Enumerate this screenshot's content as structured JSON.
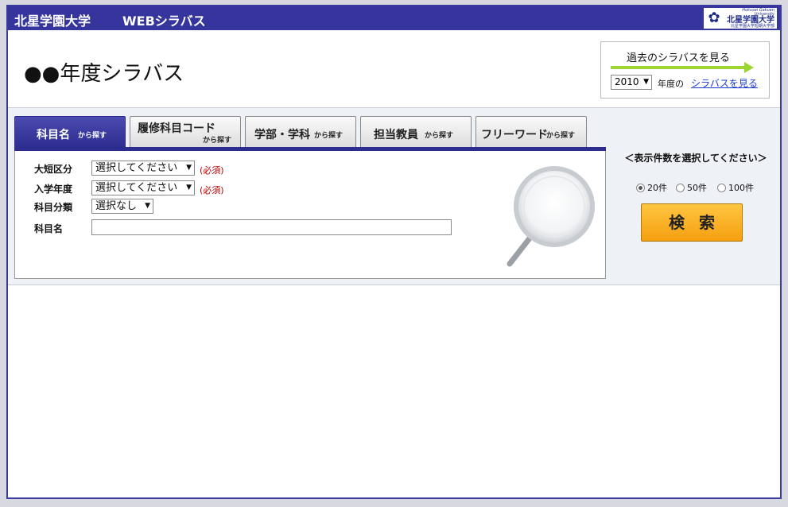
{
  "header": {
    "brand": "北星学園大学",
    "system_name": "WEBシラバス",
    "logo": {
      "en": "Hokusei Gakuen University",
      "jp": "北星学園大学",
      "sub": "北星学園大学短期大学部"
    }
  },
  "page_title": "●●年度シラバス",
  "past": {
    "label": "過去のシラバスを見る",
    "year_value": "2010",
    "year_suffix": "年度の",
    "link": "シラバスを見る"
  },
  "tabs": [
    {
      "main": "科目名",
      "small": "から探す",
      "active": true
    },
    {
      "main": "履修科目コード",
      "small": "から探す",
      "active": false
    },
    {
      "main": "学部・学科",
      "small": "から探す",
      "active": false
    },
    {
      "main": "担当教員",
      "small": "から探す",
      "active": false
    },
    {
      "main": "フリーワード",
      "small": "から探す",
      "active": false
    }
  ],
  "form": {
    "category": {
      "label": "大短区分",
      "value": "選択してください",
      "required": "(必須)"
    },
    "entry_year": {
      "label": "入学年度",
      "value": "選択してください",
      "required": "(必須)"
    },
    "subject_type": {
      "label": "科目分類",
      "value": "選択なし"
    },
    "subject_name": {
      "label": "科目名",
      "value": ""
    }
  },
  "display_count": {
    "label": "＜表示件数を選択してください＞",
    "options": [
      "20件",
      "50件",
      "100件"
    ],
    "selected": "20件"
  },
  "search_button": "検索",
  "icons": {
    "dropdown": "triangle-down-icon",
    "magnifier": "magnifier-icon",
    "logo": "university-logo-icon"
  },
  "colors": {
    "header_bg": "#36359e",
    "tab_active": "#2d2c8f",
    "search_btn": "#f8ac22",
    "arrow": "#9bd631",
    "required": "#c00000",
    "link": "#1a3bd6"
  }
}
